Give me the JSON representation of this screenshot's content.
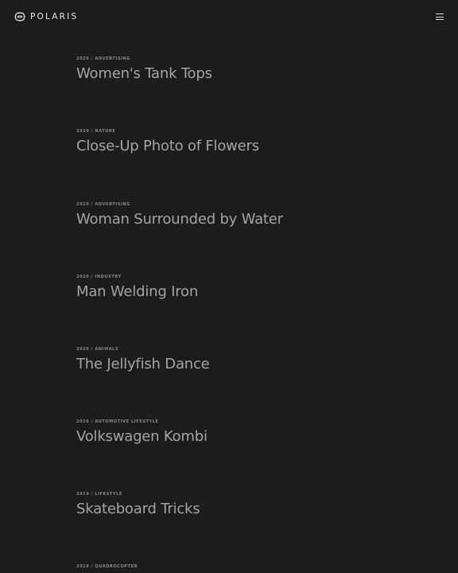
{
  "header": {
    "logo_text": "POLARIS",
    "logo_icon": "polaris-logo-icon",
    "menu_icon": "hamburger-menu-icon"
  },
  "projects": [
    {
      "meta": "2020 / ADVERTISING",
      "title": "Women's Tank Tops"
    },
    {
      "meta": "2020 / NATURE",
      "title": "Close-Up Photo of Flowers"
    },
    {
      "meta": "2020 / ADVERTISING",
      "title": "Woman Surrounded by Water"
    },
    {
      "meta": "2020 / INDUSTRY",
      "title": "Man Welding Iron"
    },
    {
      "meta": "2020 / ANIMALS",
      "title": "The Jellyfish Dance"
    },
    {
      "meta": "2019 / AUTOMOTIVE LIFESTYLE",
      "title": "Volkswagen Kombi"
    },
    {
      "meta": "2019 / LIFESTYLE",
      "title": "Skateboard Tricks"
    },
    {
      "meta": "2019 / QUADROCOPTER",
      "title": ""
    }
  ],
  "colors": {
    "background": "#1b1c1c",
    "title": "#a3a4a4",
    "meta": "#8a8b8b",
    "logo": "#e6e6e6"
  }
}
